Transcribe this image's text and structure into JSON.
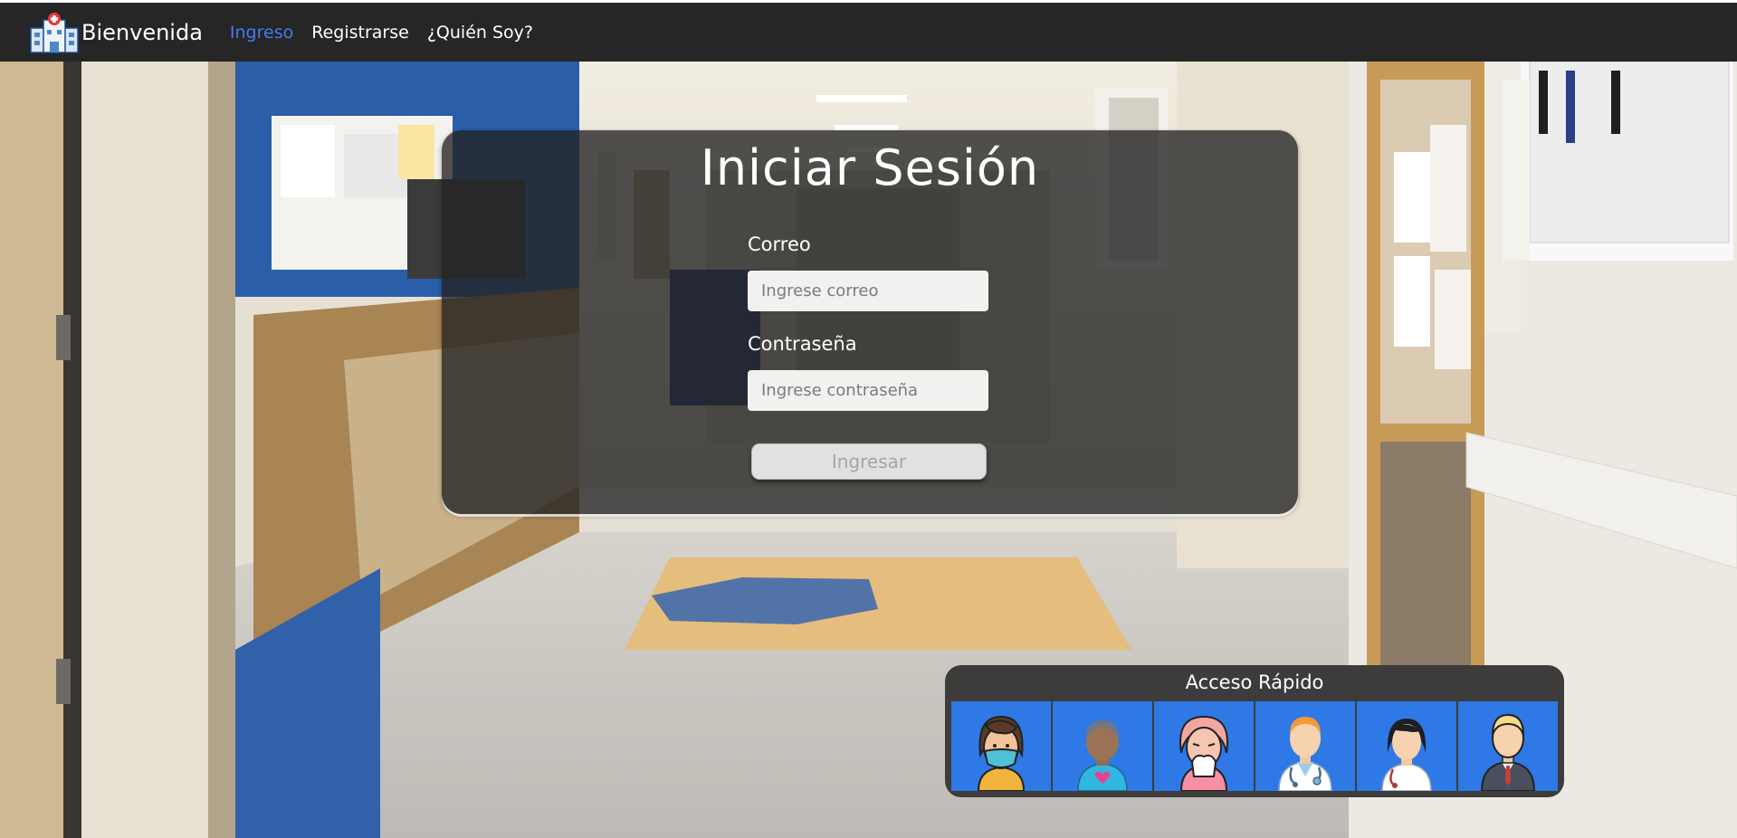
{
  "navbar": {
    "brand": "Bienvenida",
    "brand_icon": "hospital-icon",
    "links": [
      {
        "label": "Ingreso",
        "active": true
      },
      {
        "label": "Registrarse",
        "active": false
      },
      {
        "label": "¿Quién Soy?",
        "active": false
      }
    ]
  },
  "login": {
    "title": "Iniciar Sesión",
    "email_label": "Correo",
    "email_placeholder": "Ingrese correo",
    "email_value": "",
    "password_label": "Contraseña",
    "password_placeholder": "Ingrese contraseña",
    "password_value": "",
    "submit_label": "Ingresar"
  },
  "quick_access": {
    "title": "Acceso Rápido",
    "users": [
      {
        "icon": "masked-woman-avatar-icon"
      },
      {
        "icon": "patient-heart-avatar-icon"
      },
      {
        "icon": "sick-woman-avatar-icon"
      },
      {
        "icon": "male-doctor-avatar-icon"
      },
      {
        "icon": "female-doctor-avatar-icon"
      },
      {
        "icon": "businessman-avatar-icon"
      }
    ]
  },
  "colors": {
    "navbar_bg": "#262626",
    "active_link": "#3f7df6",
    "avatar_tile": "#2f79e6",
    "card_bg": "rgba(34,34,34,0.78)"
  }
}
